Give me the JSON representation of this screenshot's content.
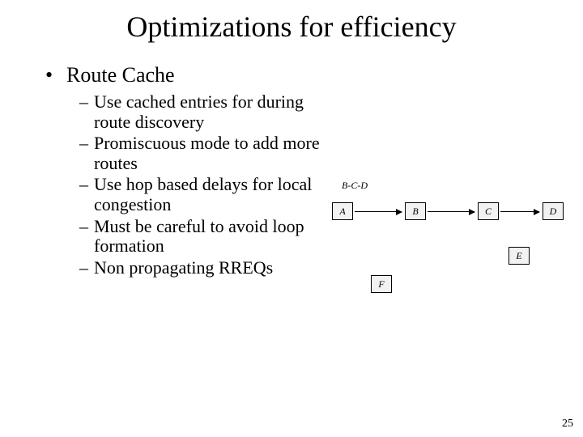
{
  "title": "Optimizations for efficiency",
  "bullet": {
    "symbol": "•",
    "text": "Route Cache"
  },
  "sub": [
    "Use cached entries for during route discovery",
    "Promiscuous mode to add more routes",
    "Use hop based delays for local congestion",
    "Must be careful to avoid loop formation",
    "Non propagating RREQs"
  ],
  "diagram": {
    "label": "B-C-D",
    "nodes": {
      "A": "A",
      "B": "B",
      "C": "C",
      "D": "D",
      "E": "E",
      "F": "F"
    }
  },
  "pagenum": "25"
}
